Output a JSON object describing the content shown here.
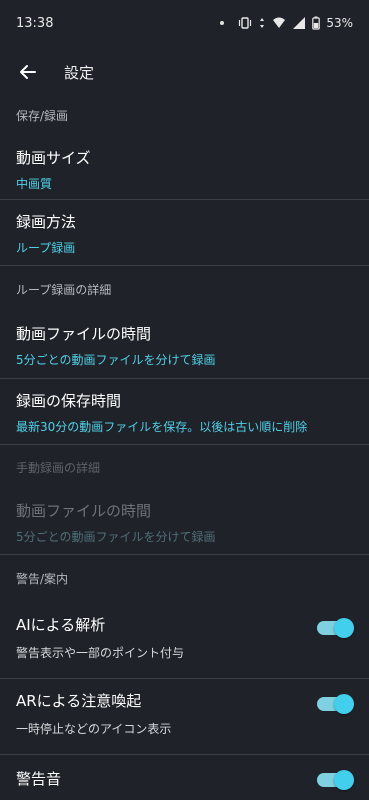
{
  "status_bar": {
    "time": "13:38",
    "battery_percent": "53%"
  },
  "app_bar": {
    "title": "設定"
  },
  "sections": {
    "save_record": {
      "header": "保存/録画",
      "video_size": {
        "title": "動画サイズ",
        "value": "中画質"
      },
      "record_method": {
        "title": "録画方法",
        "value": "ループ録画"
      }
    },
    "loop_detail": {
      "header": "ループ録画の詳細",
      "file_time": {
        "title": "動画ファイルの時間",
        "value": "5分ごとの動画ファイルを分けて録画"
      },
      "save_time": {
        "title": "録画の保存時間",
        "value": "最新30分の動画ファイルを保存。以後は古い順に削除"
      }
    },
    "manual_detail": {
      "header": "手動録画の詳細",
      "file_time": {
        "title": "動画ファイルの時間",
        "value": "5分ごとの動画ファイルを分けて録画"
      }
    },
    "warning": {
      "header": "警告/案内",
      "ai_analysis": {
        "title": "AIによる解析",
        "desc": "警告表示や一部のポイント付与",
        "enabled": true
      },
      "ar_alert": {
        "title": "ARによる注意喚起",
        "desc": "一時停止などのアイコン表示",
        "enabled": true
      },
      "warning_sound": {
        "title": "警告音",
        "enabled": true
      }
    }
  },
  "colors": {
    "background": "#1f2228",
    "accent": "#4fd1e8",
    "toggle_on": "#40d0ee"
  }
}
